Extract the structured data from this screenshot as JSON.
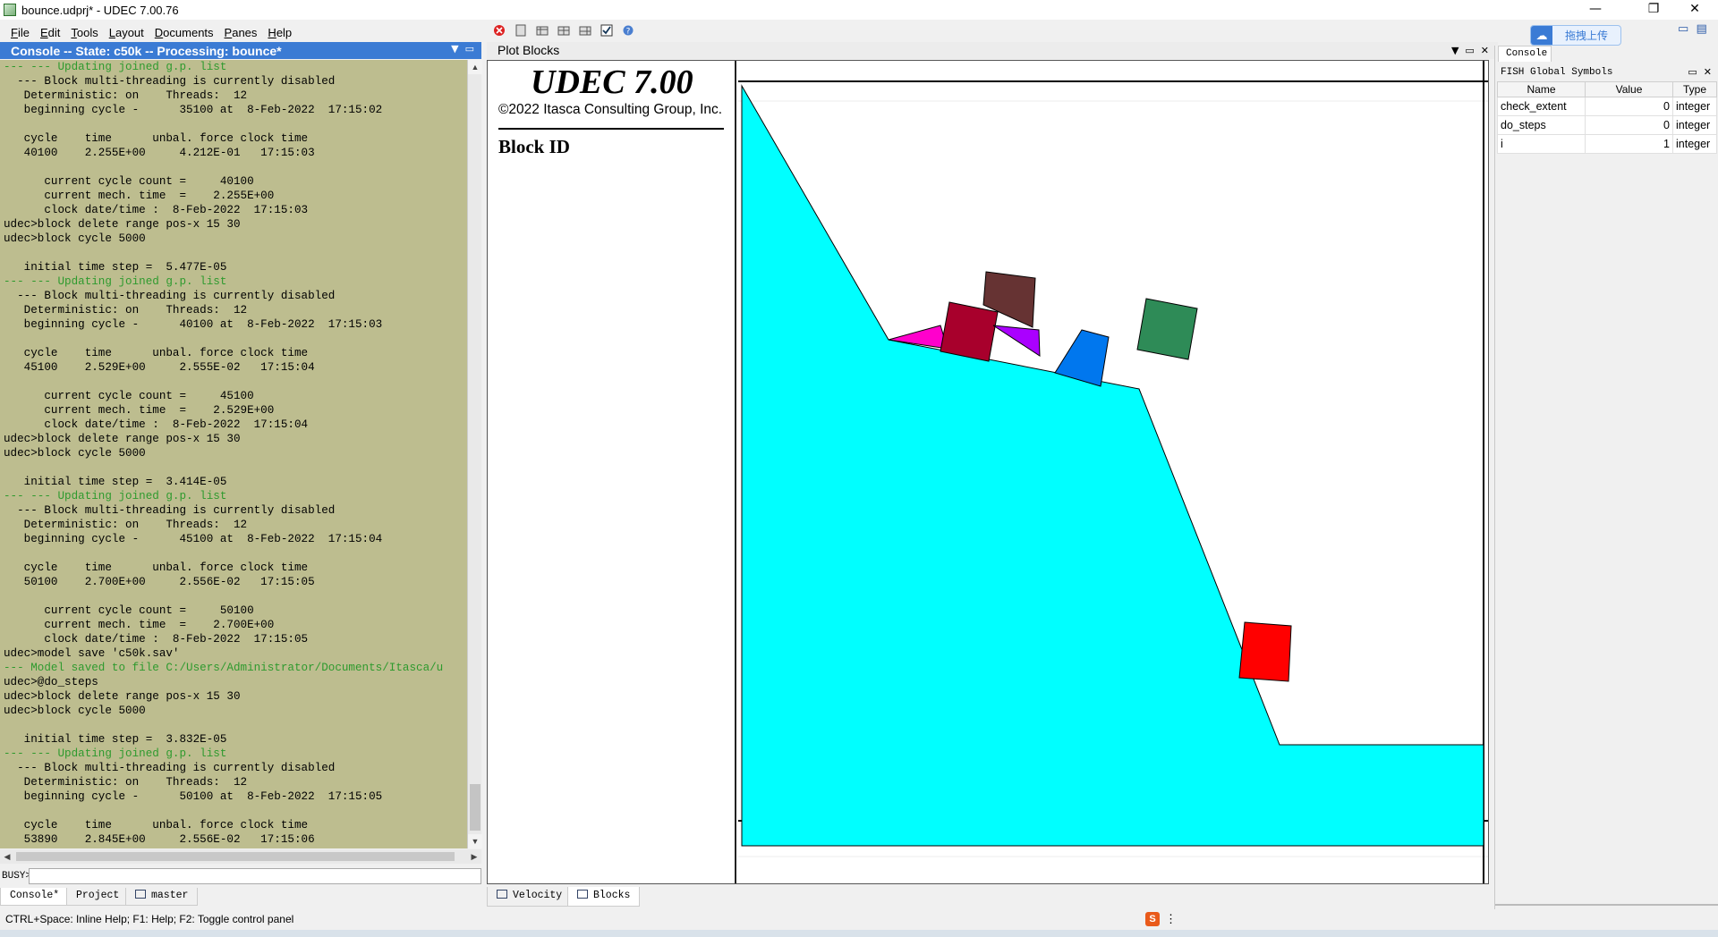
{
  "window": {
    "title": "bounce.udprj* - UDEC 7.00.76",
    "minimize": "—",
    "maximize": "❐",
    "close": "✕"
  },
  "menu": [
    "File",
    "Edit",
    "Tools",
    "Layout",
    "Documents",
    "Panes",
    "Help"
  ],
  "console": {
    "header": "Console -- State: c50k -- Processing: bounce*",
    "lines": [
      {
        "t": "--- --- Updating joined g.p. list",
        "g": true
      },
      {
        "t": "  --- Block multi-threading is currently disabled"
      },
      {
        "t": "   Deterministic: on    Threads:  12"
      },
      {
        "t": "   beginning cycle -      35100 at  8-Feb-2022  17:15:02"
      },
      {
        "t": ""
      },
      {
        "t": "   cycle    time      unbal. force clock time"
      },
      {
        "t": "   40100    2.255E+00     4.212E-01   17:15:03"
      },
      {
        "t": ""
      },
      {
        "t": "      current cycle count =     40100"
      },
      {
        "t": "      current mech. time  =    2.255E+00"
      },
      {
        "t": "      clock date/time :  8-Feb-2022  17:15:03"
      },
      {
        "t": "udec>block delete range pos-x 15 30"
      },
      {
        "t": "udec>block cycle 5000"
      },
      {
        "t": ""
      },
      {
        "t": "   initial time step =  5.477E-05"
      },
      {
        "t": "--- --- Updating joined g.p. list",
        "g": true
      },
      {
        "t": "  --- Block multi-threading is currently disabled"
      },
      {
        "t": "   Deterministic: on    Threads:  12"
      },
      {
        "t": "   beginning cycle -      40100 at  8-Feb-2022  17:15:03"
      },
      {
        "t": ""
      },
      {
        "t": "   cycle    time      unbal. force clock time"
      },
      {
        "t": "   45100    2.529E+00     2.555E-02   17:15:04"
      },
      {
        "t": ""
      },
      {
        "t": "      current cycle count =     45100"
      },
      {
        "t": "      current mech. time  =    2.529E+00"
      },
      {
        "t": "      clock date/time :  8-Feb-2022  17:15:04"
      },
      {
        "t": "udec>block delete range pos-x 15 30"
      },
      {
        "t": "udec>block cycle 5000"
      },
      {
        "t": ""
      },
      {
        "t": "   initial time step =  3.414E-05"
      },
      {
        "t": "--- --- Updating joined g.p. list",
        "g": true
      },
      {
        "t": "  --- Block multi-threading is currently disabled"
      },
      {
        "t": "   Deterministic: on    Threads:  12"
      },
      {
        "t": "   beginning cycle -      45100 at  8-Feb-2022  17:15:04"
      },
      {
        "t": ""
      },
      {
        "t": "   cycle    time      unbal. force clock time"
      },
      {
        "t": "   50100    2.700E+00     2.556E-02   17:15:05"
      },
      {
        "t": ""
      },
      {
        "t": "      current cycle count =     50100"
      },
      {
        "t": "      current mech. time  =    2.700E+00"
      },
      {
        "t": "      clock date/time :  8-Feb-2022  17:15:05"
      },
      {
        "t": "udec>model save 'c50k.sav'"
      },
      {
        "t": "--- Model saved to file C:/Users/Administrator/Documents/Itasca/u",
        "g": true
      },
      {
        "t": "udec>@do_steps"
      },
      {
        "t": "udec>block delete range pos-x 15 30"
      },
      {
        "t": "udec>block cycle 5000"
      },
      {
        "t": ""
      },
      {
        "t": "   initial time step =  3.832E-05"
      },
      {
        "t": "--- --- Updating joined g.p. list",
        "g": true
      },
      {
        "t": "  --- Block multi-threading is currently disabled"
      },
      {
        "t": "   Deterministic: on    Threads:  12"
      },
      {
        "t": "   beginning cycle -      50100 at  8-Feb-2022  17:15:05"
      },
      {
        "t": ""
      },
      {
        "t": "   cycle    time      unbal. force clock time"
      },
      {
        "t": "   53890    2.845E+00     2.556E-02   17:15:06"
      }
    ],
    "prompt_label": "BUSY>",
    "prompt_value": ""
  },
  "bottom_tabs": [
    "Console*",
    "Project",
    "master"
  ],
  "status_text": "CTRL+Space: Inline Help; F1: Help; F2: Toggle control panel",
  "plot": {
    "header": "Plot Blocks",
    "title": "UDEC 7.00",
    "copyright": "©2022 Itasca Consulting Group, Inc.",
    "legend_label": "Block ID",
    "tabs": [
      "Velocity",
      "Blocks"
    ],
    "slope_color": "#00ffff",
    "blocks": [
      {
        "color": "#ff00cc",
        "icon": "magenta-wedge"
      },
      {
        "color": "#a8002c",
        "icon": "crimson-square"
      },
      {
        "color": "#663333",
        "icon": "brown-block"
      },
      {
        "color": "#aa00ff",
        "icon": "purple-wedge"
      },
      {
        "color": "#0077ee",
        "icon": "blue-trapezoid"
      },
      {
        "color": "#2e8b57",
        "icon": "green-square"
      },
      {
        "color": "#ff0000",
        "icon": "red-square"
      }
    ]
  },
  "right_pane": {
    "cloud_button": "拖拽上传",
    "tab": "Console",
    "header": "FISH Global Symbols",
    "columns": [
      "Name",
      "Value",
      "Type"
    ],
    "rows": [
      {
        "name": "check_extent",
        "value": "0",
        "type": "integer"
      },
      {
        "name": "do_steps",
        "value": "0",
        "type": "integer"
      },
      {
        "name": "i",
        "value": "1",
        "type": "integer"
      }
    ]
  }
}
